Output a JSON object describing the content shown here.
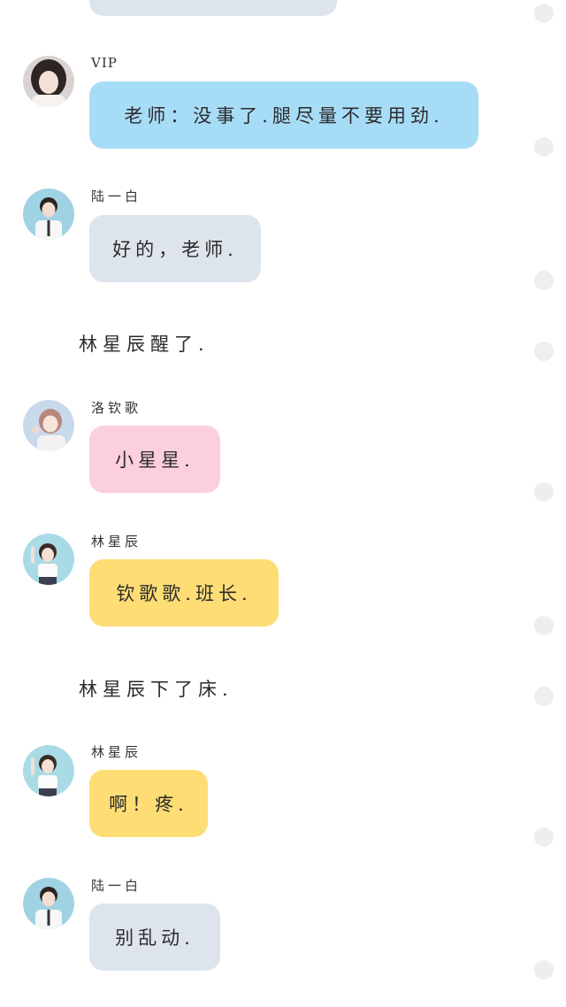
{
  "messages": [
    {
      "sender": "VIP",
      "text": "老师：没事了.腿尽量不要用劲."
    },
    {
      "sender": "陆一白",
      "text": "好的，老师."
    },
    {
      "narration": "林星辰醒了."
    },
    {
      "sender": "洛钦歌",
      "text": "小星星."
    },
    {
      "sender": "林星辰",
      "text": "钦歌歌.班长."
    },
    {
      "narration": "林星辰下了床."
    },
    {
      "sender": "林星辰",
      "text": "啊！疼."
    },
    {
      "sender": "陆一白",
      "text": "别乱动."
    }
  ],
  "colors": {
    "bubble_blue": "#a7dcf7",
    "bubble_grey": "#dde4ec",
    "bubble_pink": "#fccfdc",
    "bubble_yellow": "#fddd74",
    "side_dot": "#eeeeee"
  }
}
